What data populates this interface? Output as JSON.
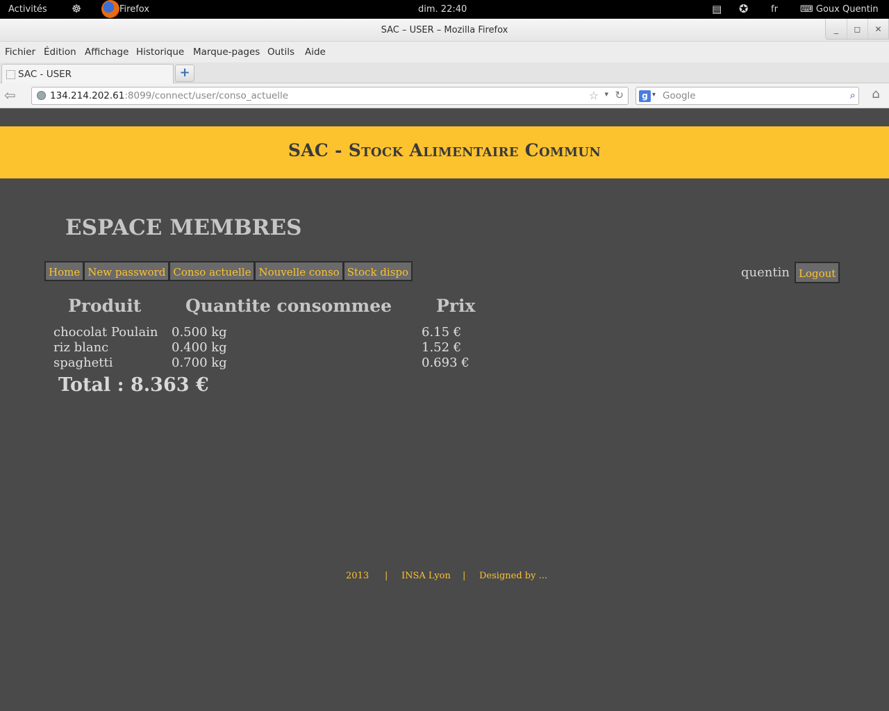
{
  "system": {
    "activities": "Activités",
    "app_name": "Firefox",
    "clock": "dim. 22:40",
    "lang": "fr",
    "user": "Goux Quentin"
  },
  "window": {
    "title": "SAC – USER – Mozilla Firefox"
  },
  "menubar": {
    "items": [
      "Fichier",
      "Édition",
      "Affichage",
      "Historique",
      "Marque-pages",
      "Outils",
      "Aide"
    ]
  },
  "tabs": [
    {
      "label": "SAC - USER"
    }
  ],
  "newtab_label": "+",
  "address": {
    "host": "134.214.202.61",
    "path": ":8099/connect/user/conso_actuelle"
  },
  "search": {
    "placeholder": "Google"
  },
  "site": {
    "title": "SAC - Stock Alimentaire Commun",
    "section": "ESPACE MEMBRES",
    "nav": [
      "Home",
      "New password",
      "Conso actuelle",
      "Nouvelle conso",
      "Stock dispo"
    ],
    "username": "quentin",
    "logout": "Logout"
  },
  "table": {
    "headers": [
      "Produit",
      "Quantite consommee",
      "Prix"
    ],
    "rows": [
      {
        "produit": "chocolat Poulain",
        "quantite": "0.500 kg",
        "prix": "6.15 €"
      },
      {
        "produit": "riz blanc",
        "quantite": "0.400 kg",
        "prix": "1.52 €"
      },
      {
        "produit": "spaghetti",
        "quantite": "0.700 kg",
        "prix": "0.693 €"
      }
    ],
    "total": "Total : 8.363 €"
  },
  "footer": {
    "year": "2013",
    "sep": "|",
    "school": "INSA Lyon",
    "designed": "Designed by ..."
  },
  "colors": {
    "accent": "#fcc32f",
    "page_bg": "#4a4a4a",
    "menu_bg": "#6a6a6a"
  },
  "icons": [
    "gear-icon",
    "firefox-logo-icon",
    "clipboard-icon",
    "accessibility-icon",
    "keyboard-icon",
    "back-icon",
    "globe-icon",
    "bookmark-star-icon",
    "reload-icon",
    "google-icon",
    "search-icon",
    "home-icon"
  ]
}
